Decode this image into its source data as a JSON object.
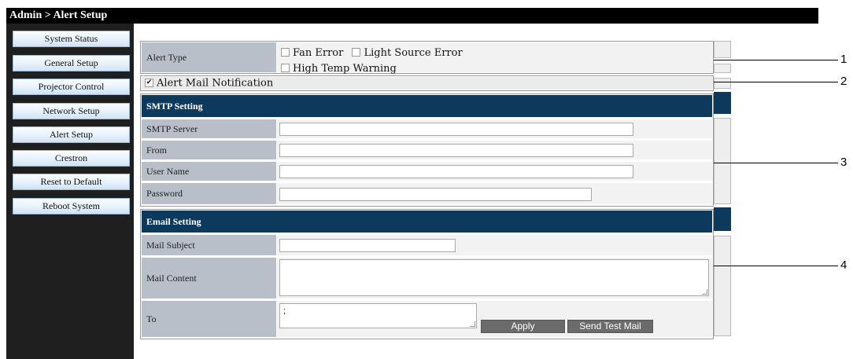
{
  "header": {
    "title": "Admin > Alert Setup"
  },
  "sidebar": {
    "items": [
      {
        "label": "System Status"
      },
      {
        "label": "General Setup"
      },
      {
        "label": "Projector Control"
      },
      {
        "label": "Network Setup"
      },
      {
        "label": "Alert Setup"
      },
      {
        "label": "Crestron"
      },
      {
        "label": "Reset to Default"
      },
      {
        "label": "Reboot System"
      }
    ]
  },
  "alert_type": {
    "label": "Alert Type",
    "options": [
      {
        "label": "Fan Error",
        "checked": false
      },
      {
        "label": "Light Source Error",
        "checked": false
      },
      {
        "label": "High Temp Warning",
        "checked": false
      }
    ]
  },
  "alert_mail": {
    "label": "Alert Mail Notification",
    "checked": true
  },
  "smtp": {
    "heading": "SMTP Setting",
    "server_label": "SMTP Server",
    "from_label": "From",
    "username_label": "User Name",
    "password_label": "Password"
  },
  "email": {
    "heading": "Email Setting",
    "subject_label": "Mail Subject",
    "content_label": "Mail Content",
    "to_label": "To",
    "to_value": ";"
  },
  "buttons": {
    "apply": "Apply",
    "send_test": "Send Test Mail"
  },
  "callouts": [
    "1",
    "2",
    "3",
    "4"
  ]
}
